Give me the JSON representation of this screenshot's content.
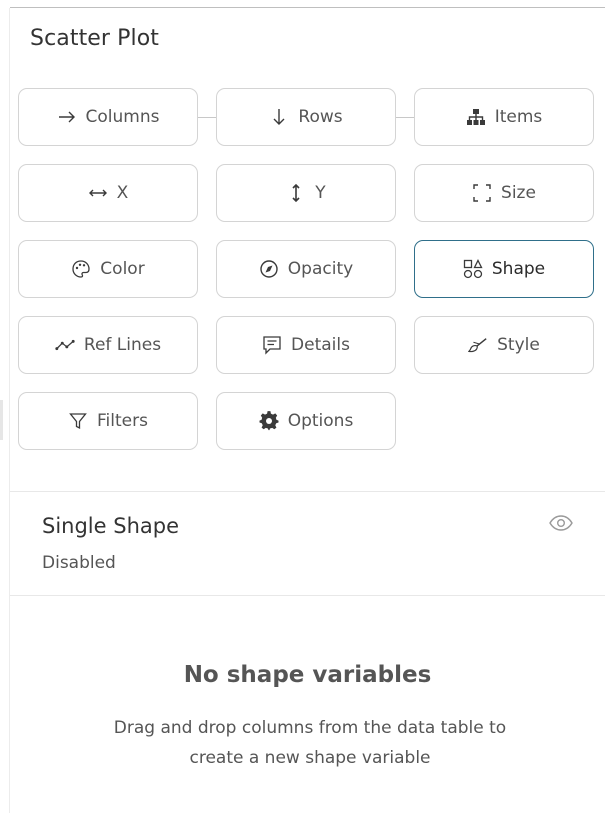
{
  "panel": {
    "title": "Scatter Plot"
  },
  "buttons": [
    {
      "label": "Columns",
      "icon": "arrow-right-icon"
    },
    {
      "label": "Rows",
      "icon": "arrow-down-icon"
    },
    {
      "label": "Items",
      "icon": "hierarchy-icon"
    },
    {
      "label": "X",
      "icon": "arrows-horizontal-icon"
    },
    {
      "label": "Y",
      "icon": "arrows-vertical-icon"
    },
    {
      "label": "Size",
      "icon": "resize-corners-icon"
    },
    {
      "label": "Color",
      "icon": "palette-icon"
    },
    {
      "label": "Opacity",
      "icon": "opacity-icon"
    },
    {
      "label": "Shape",
      "icon": "shapes-icon",
      "active": true
    },
    {
      "label": "Ref Lines",
      "icon": "trend-line-icon"
    },
    {
      "label": "Details",
      "icon": "comment-icon"
    },
    {
      "label": "Style",
      "icon": "paintbrush-icon"
    },
    {
      "label": "Filters",
      "icon": "filter-icon"
    },
    {
      "label": "Options",
      "icon": "gear-icon"
    }
  ],
  "single_shape": {
    "title": "Single Shape",
    "status": "Disabled"
  },
  "empty_state": {
    "title": "No shape variables",
    "line1": "Drag and drop columns from the data table to",
    "line2": "create a new shape variable"
  },
  "colors": {
    "accent": "#2f6f8a",
    "border": "#d4d4d4",
    "text": "#555555"
  }
}
